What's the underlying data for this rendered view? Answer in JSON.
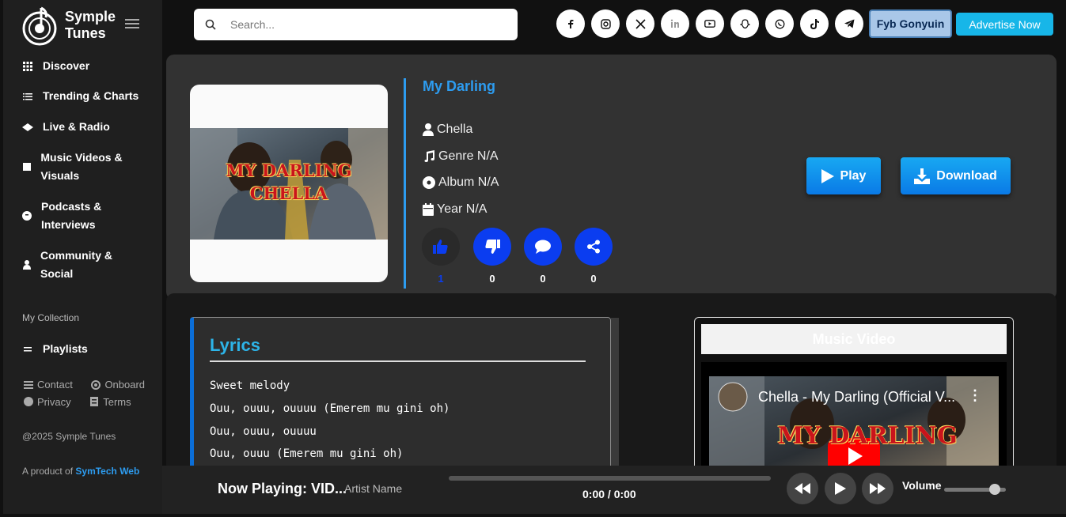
{
  "brand": {
    "name_line1": "Symple",
    "name_line2": "Tunes"
  },
  "sidebar": {
    "items": [
      {
        "label": "Discover",
        "icon": "grid-icon"
      },
      {
        "label": "Trending & Charts",
        "icon": "list-icon"
      },
      {
        "label": "Live & Radio",
        "icon": "broadcast-icon"
      },
      {
        "label": "Music Videos & Visuals",
        "icon": "video-square-icon"
      },
      {
        "label": "Podcasts & Interviews",
        "icon": "podcast-icon"
      },
      {
        "label": "Community & Social",
        "icon": "user-icon"
      }
    ],
    "collection_label": "My Collection",
    "playlists_label": "Playlists",
    "links": {
      "contact": "Contact",
      "onboard": "Onboard",
      "privacy": "Privacy",
      "terms": "Terms"
    },
    "copyright": "@2025 Symple Tunes",
    "product_prefix": "A product of",
    "product_name": "SymTech Web"
  },
  "topbar": {
    "search_placeholder": "Search...",
    "socials": [
      "facebook-icon",
      "instagram-icon",
      "x-icon",
      "linkedin-icon",
      "youtube-icon",
      "snapchat-icon",
      "whatsapp-icon",
      "tiktok-icon",
      "telegram-icon"
    ],
    "user_label": "Fyb Gonyuin",
    "advertise_label": "Advertise Now"
  },
  "song": {
    "title": "My Darling",
    "artist": "Chella",
    "genre": "Genre N/A",
    "album": "Album N/A",
    "year": "Year N/A",
    "cover_text_line1": "MY DARLING",
    "cover_text_line2": "CHELLA",
    "reactions": {
      "likes": "1",
      "dislikes": "0",
      "comments": "0",
      "shares": "0"
    },
    "play_label": "Play",
    "download_label": "Download"
  },
  "lyrics": {
    "heading": "Lyrics",
    "lines": [
      "Sweet melody",
      "Ouu, ouuu, ouuuu (Emerem mu gini oh)",
      "Ouu, ouuu, ouuuu",
      "Ouu, ouuu (Emerem mu gini oh)"
    ]
  },
  "video": {
    "heading": "Music Video",
    "title": "Chella - My Darling (Official V...",
    "thumb_text": "MY DARLING"
  },
  "player": {
    "now_playing": "Now Playing: VID...",
    "artist": "Artist Name",
    "time": "0:00 / 0:00",
    "volume_label": "Volume",
    "volume_level": 0.82,
    "progress": 0
  },
  "colors": {
    "accent": "#2d9cf0",
    "button": "#0a7ae6",
    "reaction": "#0b3df0",
    "lyrics_border": "#0b6ed8"
  }
}
